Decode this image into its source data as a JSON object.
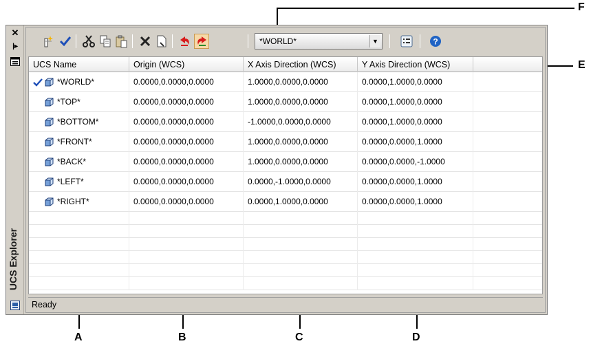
{
  "palette": {
    "title": "UCS Explorer",
    "title_icons": [
      "close-icon",
      "auto-hide-icon",
      "properties-icon"
    ]
  },
  "toolbar": {
    "buttons": [
      "new-ucs-icon",
      "set-current-icon",
      "cut-icon",
      "copy-icon",
      "paste-icon",
      "delete-icon",
      "properties-icon",
      "undo-icon",
      "redo-icon"
    ],
    "current_ucs": "*WORLD*",
    "view_button": "details-view-icon",
    "help_button": "help-icon"
  },
  "grid": {
    "columns": [
      "UCS Name",
      "Origin (WCS)",
      "X Axis Direction (WCS)",
      "Y Axis Direction (WCS)"
    ],
    "rows": [
      {
        "name": "*WORLD*",
        "origin": "0.0000,0.0000,0.0000",
        "x_axis": "1.0000,0.0000,0.0000",
        "y_axis": "0.0000,1.0000,0.0000",
        "current": true
      },
      {
        "name": "*TOP*",
        "origin": "0.0000,0.0000,0.0000",
        "x_axis": "1.0000,0.0000,0.0000",
        "y_axis": "0.0000,1.0000,0.0000",
        "current": false
      },
      {
        "name": "*BOTTOM*",
        "origin": "0.0000,0.0000,0.0000",
        "x_axis": "-1.0000,0.0000,0.0000",
        "y_axis": "0.0000,1.0000,0.0000",
        "current": false
      },
      {
        "name": "*FRONT*",
        "origin": "0.0000,0.0000,0.0000",
        "x_axis": "1.0000,0.0000,0.0000",
        "y_axis": "0.0000,0.0000,1.0000",
        "current": false
      },
      {
        "name": "*BACK*",
        "origin": "0.0000,0.0000,0.0000",
        "x_axis": "1.0000,0.0000,0.0000",
        "y_axis": "0.0000,0.0000,-1.0000",
        "current": false
      },
      {
        "name": "*LEFT*",
        "origin": "0.0000,0.0000,0.0000",
        "x_axis": "0.0000,-1.0000,0.0000",
        "y_axis": "0.0000,0.0000,1.0000",
        "current": false
      },
      {
        "name": "*RIGHT*",
        "origin": "0.0000,0.0000,0.0000",
        "x_axis": "0.0000,1.0000,0.0000",
        "y_axis": "0.0000,0.0000,1.0000",
        "current": false
      }
    ]
  },
  "status": "Ready",
  "callouts": [
    "A",
    "B",
    "C",
    "D",
    "E",
    "F"
  ],
  "colors": {
    "checkmark": "#1e4fb8",
    "cube": "#2d6cc0",
    "cut_delete": "#222222",
    "undo_redo": "#d81c1c",
    "help": "#1f63c4"
  }
}
